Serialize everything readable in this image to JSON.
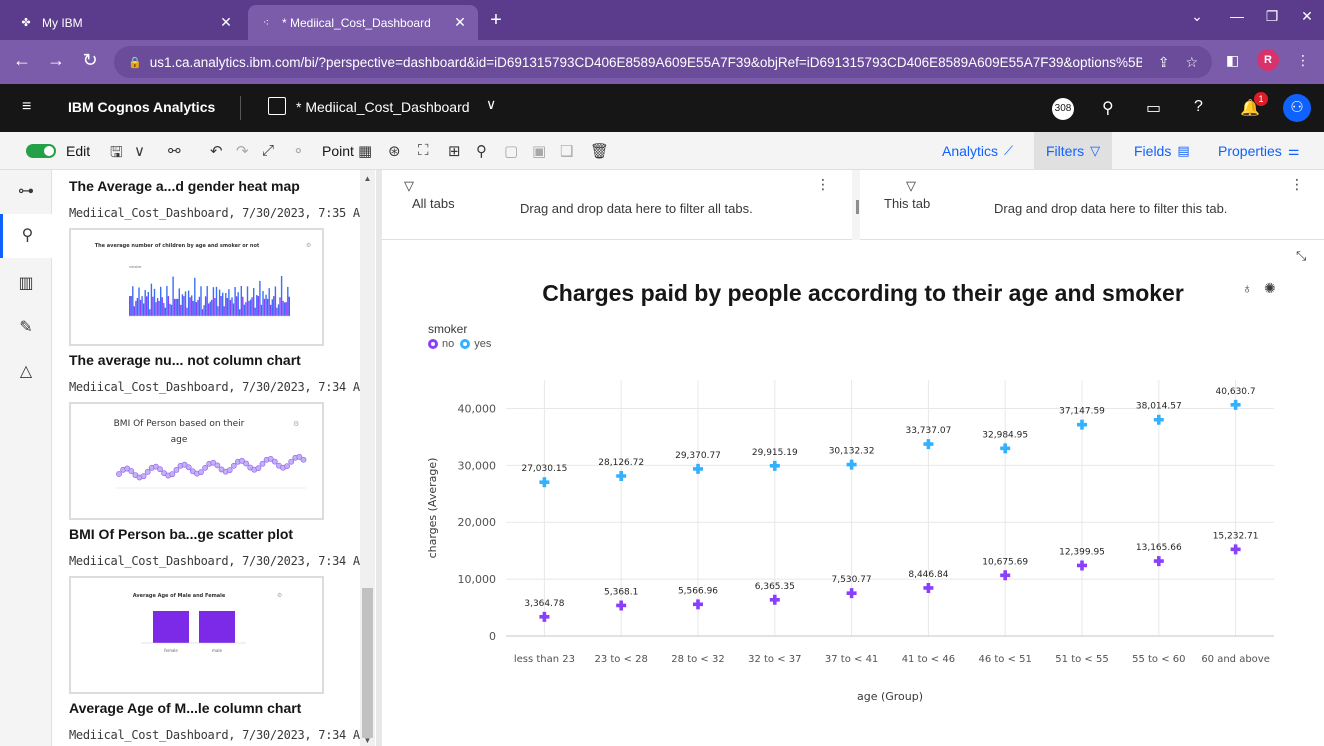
{
  "browser": {
    "tabs": [
      {
        "title": "My IBM",
        "favicon": "ibm-icon",
        "active": false
      },
      {
        "title": "* Mediical_Cost_Dashboard",
        "favicon": "cognos-icon",
        "active": true
      }
    ],
    "url": "us1.ca.analytics.ibm.com/bi/?perspective=dashboard&id=iD691315793CD406E8589A609E55A7F39&objRef=iD691315793CD406E8589A609E55A7F39&options%5Bdisa...",
    "profile_initial": "R"
  },
  "app": {
    "brand": "IBM Cognos Analytics",
    "dashboard_title": "* Mediical_Cost_Dashboard",
    "notif_count": "308",
    "alert_count": "1"
  },
  "toolbar": {
    "edit_label": "Edit",
    "point_label": "Point",
    "analytics_label": "Analytics",
    "filters_label": "Filters",
    "fields_label": "Fields",
    "properties_label": "Properties"
  },
  "panel": {
    "cards": [
      {
        "title": "The Average a...d gender heat map",
        "meta": "Mediical_Cost_Dashboard, 7/30/2023, 7:35 AM"
      },
      {
        "title": "The average nu... not column chart",
        "meta": "Mediical_Cost_Dashboard, 7/30/2023, 7:34 AM",
        "thumb_title": "The average number of children by age and smoker or not",
        "thumb_legend": "smoker"
      },
      {
        "title": "BMI Of Person ba...ge scatter plot",
        "meta": "Mediical_Cost_Dashboard, 7/30/2023, 7:34 AM",
        "thumb_title": "BMI Of Person based on their age"
      },
      {
        "title": "Average Age of M...le column chart",
        "meta": "Mediical_Cost_Dashboard, 7/30/2023, 7:34 AM",
        "thumb_title": "Average Age of Male and Female",
        "thumb_cats": [
          "female",
          "male"
        ]
      }
    ]
  },
  "filters": {
    "all_tabs_label": "All tabs",
    "all_tabs_hint": "Drag and drop data here to filter all tabs.",
    "this_tab_label": "This tab",
    "this_tab_hint": "Drag and drop data here to filter this tab."
  },
  "colors": {
    "no": "#8a3ffc",
    "yes": "#33b1ff",
    "accent": "#0f62fe"
  },
  "chart_data": {
    "type": "scatter",
    "title": "Charges paid by people according to their age and smoker",
    "legend_title": "smoker",
    "legend_placement": "top-left",
    "xlabel": "age (Group)",
    "ylabel": "charges (Average)",
    "categories": [
      "less than 23",
      "23 to < 28",
      "28 to < 32",
      "32 to < 37",
      "37 to < 41",
      "41 to < 46",
      "46 to < 51",
      "51 to < 55",
      "55 to < 60",
      "60 and above"
    ],
    "ylim": [
      0,
      45000
    ],
    "yticks": [
      0,
      10000,
      20000,
      30000,
      40000
    ],
    "ytick_labels": [
      "0",
      "10,000",
      "20,000",
      "30,000",
      "40,000"
    ],
    "grid": true,
    "series": [
      {
        "name": "no",
        "values": [
          3364.78,
          5368.1,
          5566.96,
          6365.35,
          7530.77,
          8446.84,
          10675.69,
          12399.95,
          13165.66,
          15232.71
        ],
        "labels": [
          "3,364.78",
          "5,368.1",
          "5,566.96",
          "6,365.35",
          "7,530.77",
          "8,446.84",
          "10,675.69",
          "12,399.95",
          "13,165.66",
          "15,232.71"
        ]
      },
      {
        "name": "yes",
        "values": [
          27030.15,
          28126.72,
          29370.77,
          29915.19,
          30132.32,
          33737.07,
          32984.95,
          37147.59,
          38014.57,
          40630.7
        ],
        "labels": [
          "27,030.15",
          "28,126.72",
          "29,370.77",
          "29,915.19",
          "30,132.32",
          "33,737.07",
          "32,984.95",
          "37,147.59",
          "38,014.57",
          "40,630.7"
        ]
      }
    ]
  }
}
